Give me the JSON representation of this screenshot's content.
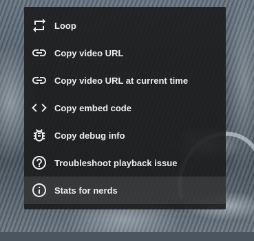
{
  "context_menu": {
    "items": [
      {
        "label": "Loop",
        "icon": "loop-icon"
      },
      {
        "label": "Copy video URL",
        "icon": "link-icon"
      },
      {
        "label": "Copy video URL at current time",
        "icon": "link-icon"
      },
      {
        "label": "Copy embed code",
        "icon": "code-icon"
      },
      {
        "label": "Copy debug info",
        "icon": "bug-icon"
      },
      {
        "label": "Troubleshoot playback issue",
        "icon": "help-circle-icon"
      },
      {
        "label": "Stats for nerds",
        "icon": "info-circle-icon",
        "highlighted": true
      }
    ]
  },
  "colors": {
    "menu_background": "#1c1c1c",
    "menu_text": "#eeeeee",
    "highlight": "#3a3a3a"
  }
}
